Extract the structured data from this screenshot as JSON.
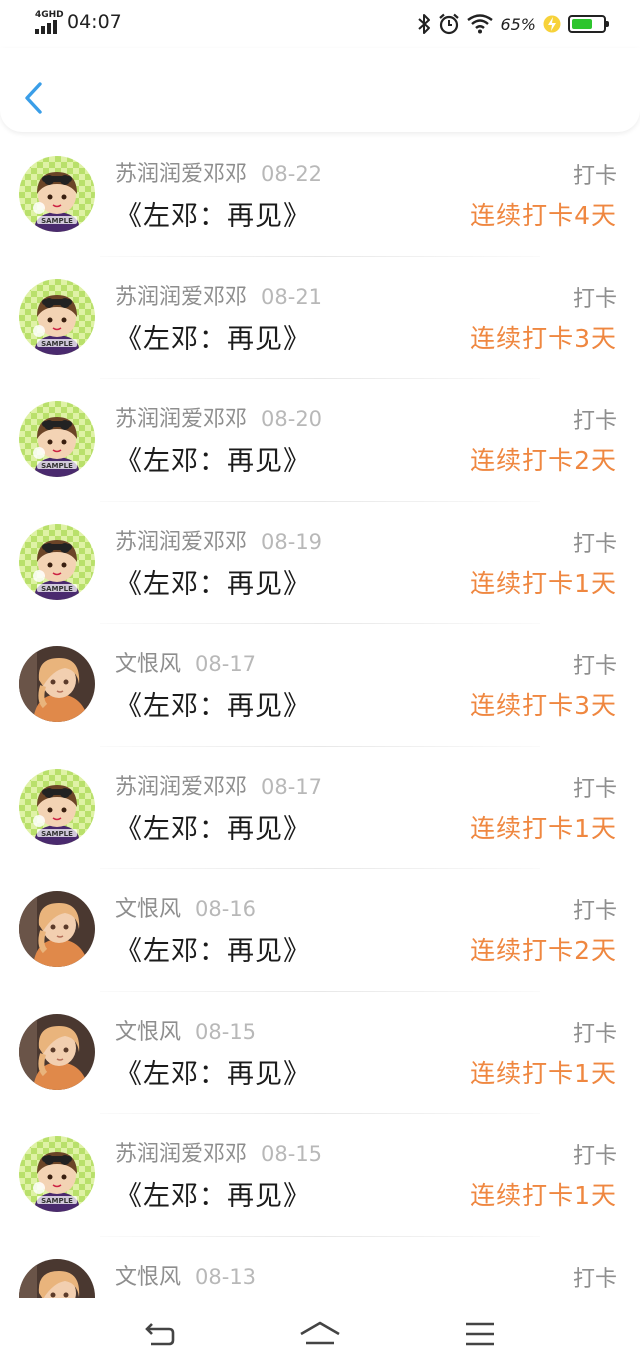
{
  "status_bar": {
    "network": "4GHD",
    "time": "04:07",
    "battery_percent": "65%",
    "battery_level": 0.65,
    "icons": [
      "bluetooth-icon",
      "alarm-icon",
      "wifi-icon",
      "charging-bolt-icon",
      "battery-icon"
    ]
  },
  "header": {
    "back_icon": "chevron-left-icon"
  },
  "colors": {
    "accent_blue": "#3a9ee8",
    "streak_orange": "#ef8740",
    "name_gray": "#8e8e8e",
    "date_gray": "#b8b8b8",
    "title_black": "#1b1b1b",
    "battery_green": "#2ec52e"
  },
  "records": [
    {
      "user": "苏润润爱邓邓",
      "date": "08-22",
      "label": "打卡",
      "book": "《左邓：再见》",
      "streak": "连续打卡4天",
      "avatar": "avatar-a"
    },
    {
      "user": "苏润润爱邓邓",
      "date": "08-21",
      "label": "打卡",
      "book": "《左邓：再见》",
      "streak": "连续打卡3天",
      "avatar": "avatar-a"
    },
    {
      "user": "苏润润爱邓邓",
      "date": "08-20",
      "label": "打卡",
      "book": "《左邓：再见》",
      "streak": "连续打卡2天",
      "avatar": "avatar-a"
    },
    {
      "user": "苏润润爱邓邓",
      "date": "08-19",
      "label": "打卡",
      "book": "《左邓：再见》",
      "streak": "连续打卡1天",
      "avatar": "avatar-a"
    },
    {
      "user": "文恨风",
      "date": "08-17",
      "label": "打卡",
      "book": "《左邓：再见》",
      "streak": "连续打卡3天",
      "avatar": "avatar-b"
    },
    {
      "user": "苏润润爱邓邓",
      "date": "08-17",
      "label": "打卡",
      "book": "《左邓：再见》",
      "streak": "连续打卡1天",
      "avatar": "avatar-a"
    },
    {
      "user": "文恨风",
      "date": "08-16",
      "label": "打卡",
      "book": "《左邓：再见》",
      "streak": "连续打卡2天",
      "avatar": "avatar-b"
    },
    {
      "user": "文恨风",
      "date": "08-15",
      "label": "打卡",
      "book": "《左邓：再见》",
      "streak": "连续打卡1天",
      "avatar": "avatar-b"
    },
    {
      "user": "苏润润爱邓邓",
      "date": "08-15",
      "label": "打卡",
      "book": "《左邓：再见》",
      "streak": "连续打卡1天",
      "avatar": "avatar-a"
    },
    {
      "user": "文恨风",
      "date": "08-13",
      "label": "打卡",
      "book": "",
      "streak": "",
      "avatar": "avatar-b"
    }
  ],
  "nav_bar": {
    "buttons": [
      "back-nav-icon",
      "home-nav-icon",
      "menu-nav-icon"
    ]
  }
}
